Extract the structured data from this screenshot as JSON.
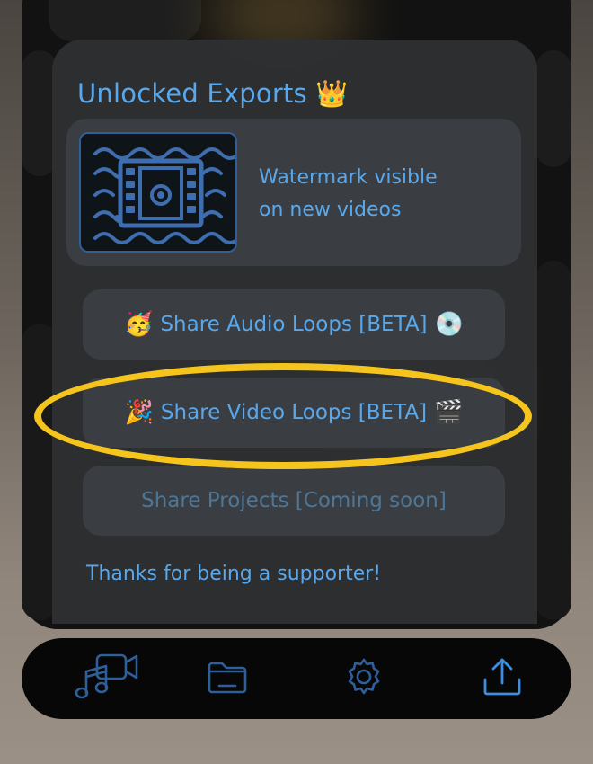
{
  "panel": {
    "title": "Unlocked Exports 👑",
    "watermark": {
      "line1": "Watermark visible",
      "line2": "on new videos",
      "icon": "film-waves-icon"
    },
    "buttons": [
      {
        "emoji_left": "🥳",
        "label": "Share Audio Loops [BETA]",
        "emoji_right": "💿",
        "enabled": true
      },
      {
        "emoji_left": "🎉",
        "label": "Share Video Loops [BETA]",
        "emoji_right": "🎬",
        "enabled": true,
        "highlighted": true
      },
      {
        "label": "Share Projects [Coming soon]",
        "enabled": false
      }
    ],
    "thanks": "Thanks for being a supporter!"
  },
  "tabbar": {
    "items": [
      {
        "icon": "music-video-icon",
        "active": true
      },
      {
        "icon": "folder-icon",
        "active": false
      },
      {
        "icon": "gear-icon",
        "active": false
      },
      {
        "icon": "share-upload-icon",
        "active": false
      }
    ]
  },
  "colors": {
    "accent": "#5aa8ec",
    "highlight": "#f5c51e",
    "panel": "#2e3032",
    "card": "#3a3e42"
  }
}
